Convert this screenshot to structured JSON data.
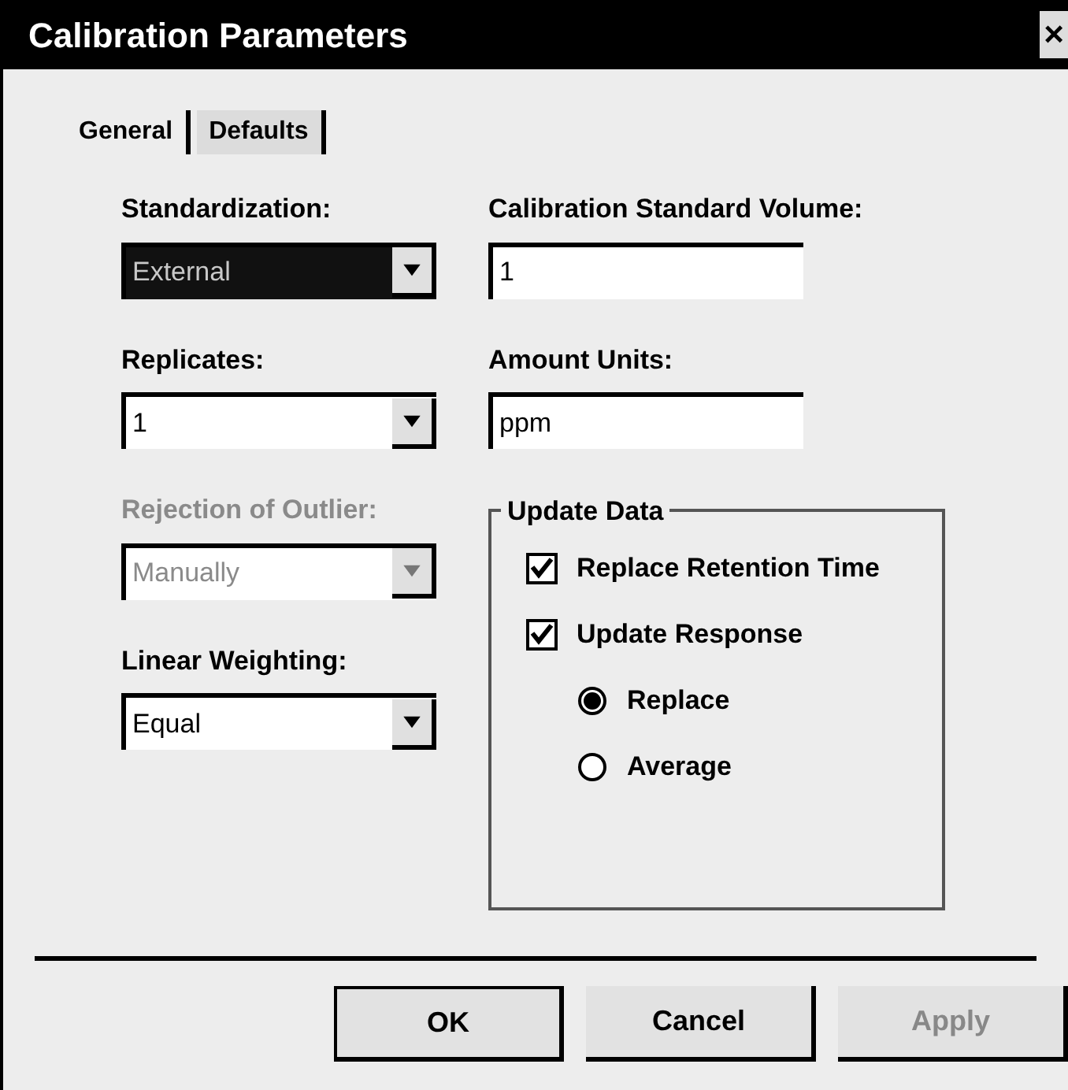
{
  "window": {
    "title": "Calibration Parameters",
    "close": "×"
  },
  "tabs": [
    {
      "label": "General",
      "selected": true
    },
    {
      "label": "Defaults",
      "selected": false
    }
  ],
  "left_fields": [
    {
      "label": "Standardization:",
      "value": "External",
      "disabled": false,
      "highlighted": true
    },
    {
      "label": "Replicates:",
      "value": "1",
      "disabled": false,
      "highlighted": false
    },
    {
      "label": "Rejection of Outlier:",
      "value": "Manually",
      "disabled": true,
      "highlighted": false
    },
    {
      "label": "Linear Weighting:",
      "value": "Equal",
      "disabled": false,
      "highlighted": false
    }
  ],
  "right_fields": [
    {
      "label": "Calibration Standard Volume:",
      "value": "1"
    },
    {
      "label": "Amount Units:",
      "value": "ppm"
    }
  ],
  "update_data": {
    "title": "Update Data",
    "options": [
      {
        "kind": "checkbox",
        "label": "Replace Retention Time",
        "checked": true
      },
      {
        "kind": "checkbox",
        "label": "Update Response",
        "checked": true
      },
      {
        "kind": "radio",
        "label": "Replace",
        "selected": true
      },
      {
        "kind": "radio",
        "label": "Average",
        "selected": false
      }
    ]
  },
  "buttons": [
    {
      "label": "OK",
      "disabled": false
    },
    {
      "label": "Cancel",
      "disabled": false
    },
    {
      "label": "Apply",
      "disabled": true
    }
  ]
}
